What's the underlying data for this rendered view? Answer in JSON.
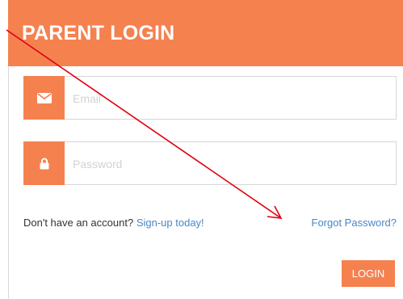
{
  "header": {
    "title": "PARENT LOGIN"
  },
  "form": {
    "email_placeholder": "Email",
    "password_placeholder": "Password",
    "email_icon": "envelope-icon",
    "password_icon": "lock-icon"
  },
  "links": {
    "signup_prompt": "Don't have an account?",
    "signup_link": "Sign-up today!",
    "forgot_password": "Forgot Password?"
  },
  "buttons": {
    "login_label": "LOGIN"
  },
  "colors": {
    "accent": "#f5814f",
    "link": "#4a86c5",
    "annotation_arrow": "#e0000f"
  }
}
